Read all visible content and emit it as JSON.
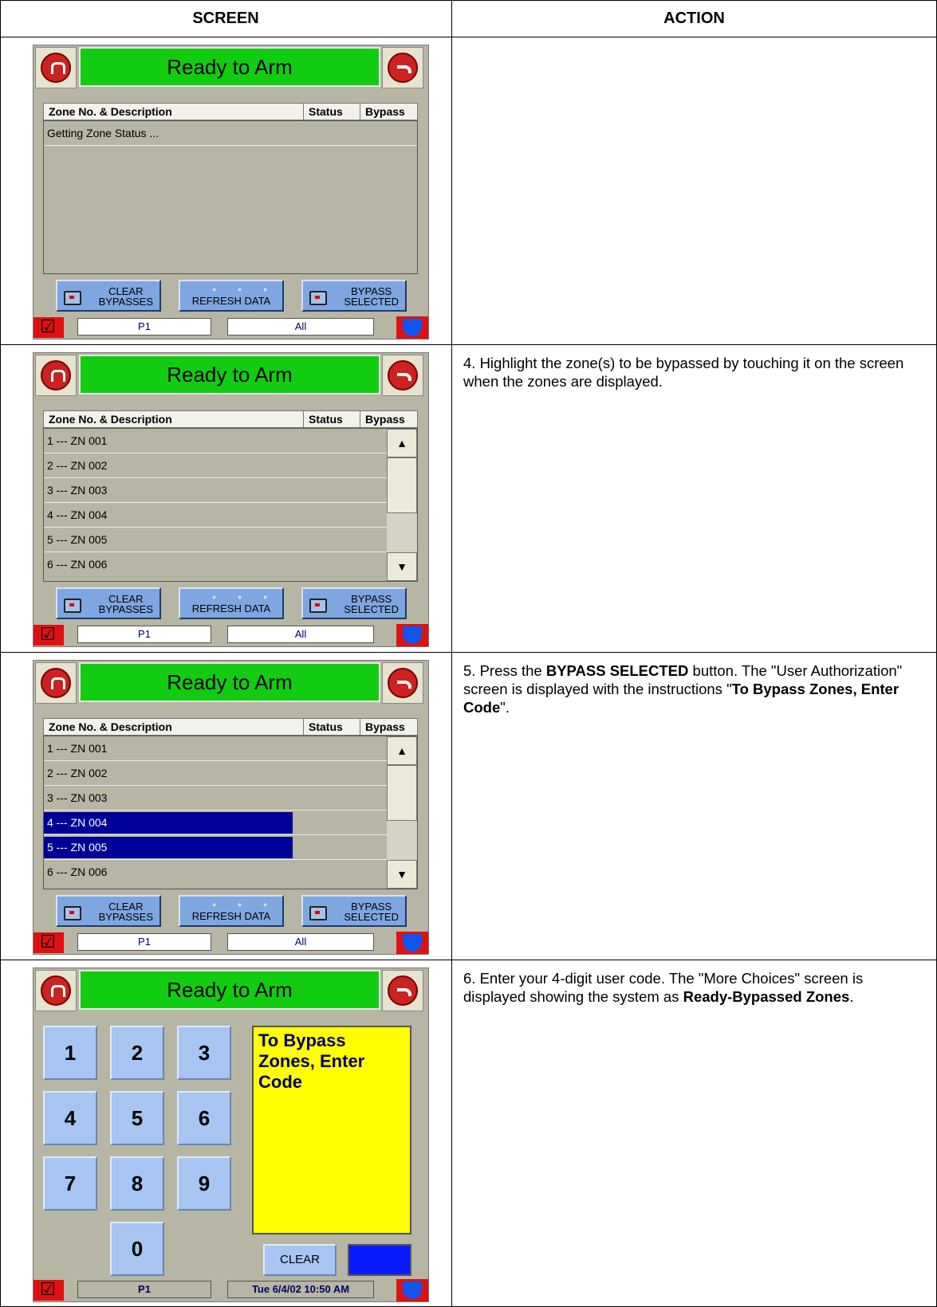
{
  "table": {
    "header_screen": "SCREEN",
    "header_action": "ACTION"
  },
  "device": {
    "title": "Ready to Arm",
    "zone_header": {
      "desc": "Zone No. & Description",
      "status": "Status",
      "bypass": "Bypass"
    },
    "buttons": {
      "clear_top": "CLEAR",
      "clear_bottom": "BYPASSES",
      "refresh": "REFRESH DATA",
      "bypass_top": "BYPASS",
      "bypass_bottom": "SELECTED"
    },
    "footer": {
      "partition": "P1",
      "filter": "All"
    },
    "zones": [
      "1 --- ZN 001",
      "2 --- ZN 002",
      "3 --- ZN 003",
      "4 --- ZN 004",
      "5 --- ZN 005",
      "6 --- ZN 006"
    ],
    "loading_text": "Getting Zone Status ...",
    "scroll_up": "▲",
    "scroll_down": "▼"
  },
  "keypad": {
    "keys": [
      "1",
      "2",
      "3",
      "4",
      "5",
      "6",
      "7",
      "8",
      "9",
      "0"
    ],
    "message": "To Bypass Zones, Enter Code",
    "clear": "CLEAR",
    "partition": "P1",
    "datetime": "Tue 6/4/02 10:50 AM"
  },
  "steps": {
    "s4": "4.  Highlight the zone(s) to be bypassed by touching it on the screen when the zones are displayed.",
    "s5_a": "5.  Press the ",
    "s5_b": "BYPASS SELECTED",
    "s5_c": " button. The \"User Authorization\" screen is displayed with the instructions \"",
    "s5_d": "To Bypass Zones, Enter Code",
    "s5_e": "\".",
    "s6_a": "6.  Enter your 4-digit user code.  The \"More Choices\" screen is displayed showing the system as ",
    "s6_b": "Ready-Bypassed Zones",
    "s6_c": "."
  },
  "colors": {
    "title_green": "#11cc11",
    "panel_gray": "#b7b5a3",
    "selection_blue": "#000099",
    "message_yellow": "#ffff00"
  }
}
